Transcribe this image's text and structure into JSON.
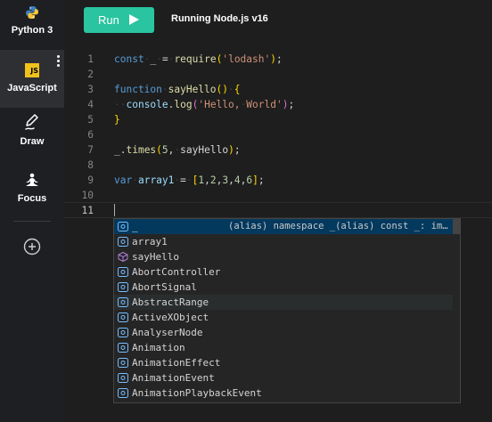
{
  "sidebar": {
    "items": [
      {
        "label": "Python 3",
        "icon": "python-icon"
      },
      {
        "label": "JavaScript",
        "icon": "js-icon",
        "badge": "JS",
        "active": true
      },
      {
        "label": "Draw",
        "icon": "pen-icon"
      },
      {
        "label": "Focus",
        "icon": "meditation-icon"
      }
    ],
    "add_icon": "plus-circle-icon",
    "menu_icon": "kebab-menu-icon"
  },
  "toolbar": {
    "run_label": "Run",
    "run_icon": "play-icon",
    "status": "Running Node.js v16"
  },
  "colors": {
    "run_button": "#2ac4a0",
    "js_badge": "#f0c21c",
    "selection": "#04395e",
    "keyword": "#569cd6",
    "string": "#ce9178"
  },
  "editor": {
    "line_numbers": [
      "1",
      "2",
      "3",
      "4",
      "5",
      "6",
      "7",
      "8",
      "9",
      "10",
      "11"
    ],
    "current_line": "11"
  },
  "suggest": {
    "items": [
      {
        "label": "_",
        "detail": "(alias) namespace _(alias) const _: import(\"lodash\")",
        "icon": "variable-icon"
      },
      {
        "label": "array1",
        "icon": "variable-icon"
      },
      {
        "label": "sayHello",
        "icon": "method-icon"
      },
      {
        "label": "AbortController",
        "icon": "variable-icon"
      },
      {
        "label": "AbortSignal",
        "icon": "variable-icon"
      },
      {
        "label": "AbstractRange",
        "icon": "variable-icon"
      },
      {
        "label": "ActiveXObject",
        "icon": "variable-icon"
      },
      {
        "label": "AnalyserNode",
        "icon": "variable-icon"
      },
      {
        "label": "Animation",
        "icon": "variable-icon"
      },
      {
        "label": "AnimationEffect",
        "icon": "variable-icon"
      },
      {
        "label": "AnimationEvent",
        "icon": "variable-icon"
      },
      {
        "label": "AnimationPlaybackEvent",
        "icon": "variable-icon"
      }
    ]
  }
}
